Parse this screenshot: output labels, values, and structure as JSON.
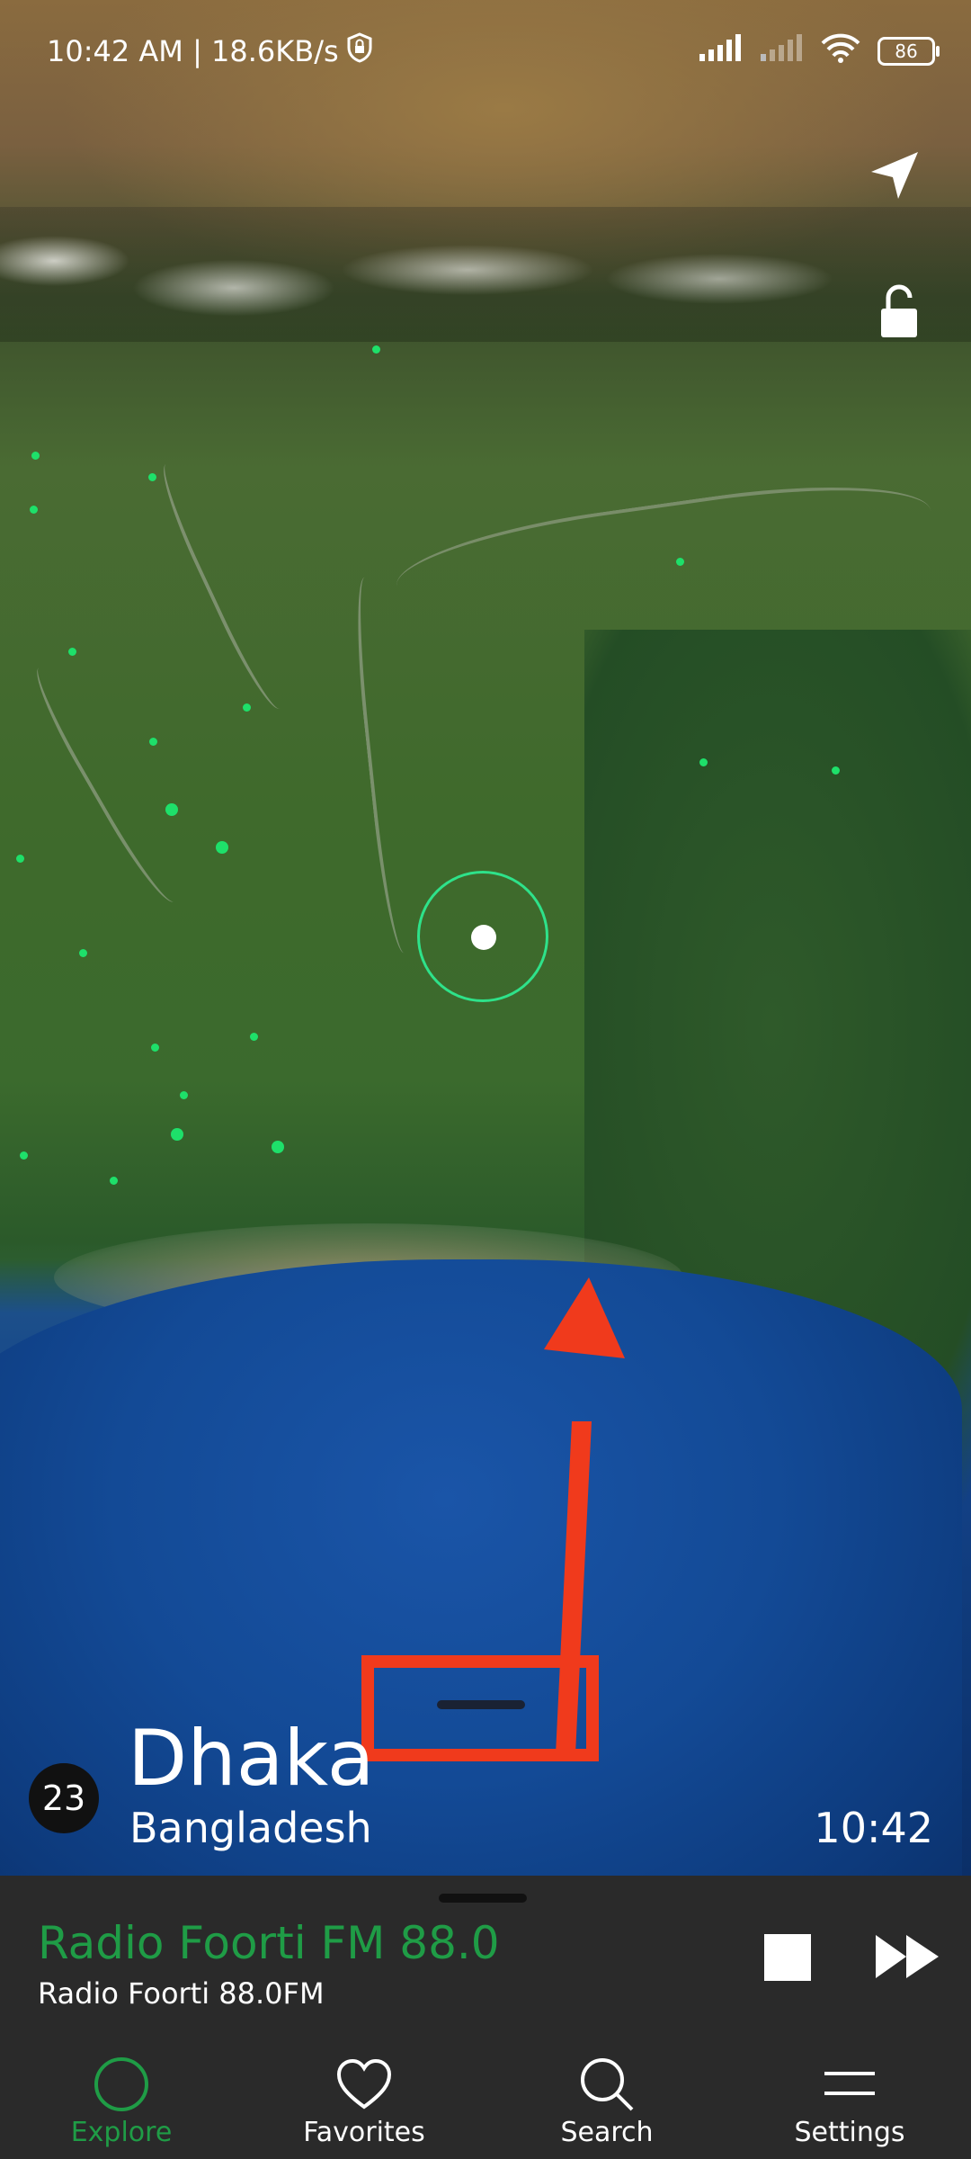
{
  "status_bar": {
    "time_speed": "10:42 AM | 18.6KB/s",
    "battery": "86",
    "icons": [
      "vpn-shield-icon",
      "signal-icon",
      "signal-weak-icon",
      "wifi-icon",
      "battery-icon"
    ]
  },
  "map_controls": {
    "locate_icon": "navigation-arrow-icon",
    "lock_icon": "unlock-icon"
  },
  "location": {
    "station_count": "23",
    "city": "Dhaka",
    "country": "Bangladesh",
    "local_time": "10:42"
  },
  "player": {
    "station_name": "Radio Foorti FM 88.0",
    "now_playing": "Radio Foorti 88.0FM",
    "stop_icon": "stop-icon",
    "next_icon": "fast-forward-icon"
  },
  "nav": {
    "items": [
      {
        "label": "Explore",
        "icon": "circle-icon",
        "active": true
      },
      {
        "label": "Favorites",
        "icon": "heart-icon",
        "active": false
      },
      {
        "label": "Search",
        "icon": "search-icon",
        "active": false
      },
      {
        "label": "Settings",
        "icon": "menu-icon",
        "active": false
      }
    ]
  },
  "colors": {
    "accent_green": "#1f9c46",
    "ring_green": "#2ee28a",
    "player_bg": "#2a2a2a",
    "annotation_red": "#f03a1c"
  }
}
